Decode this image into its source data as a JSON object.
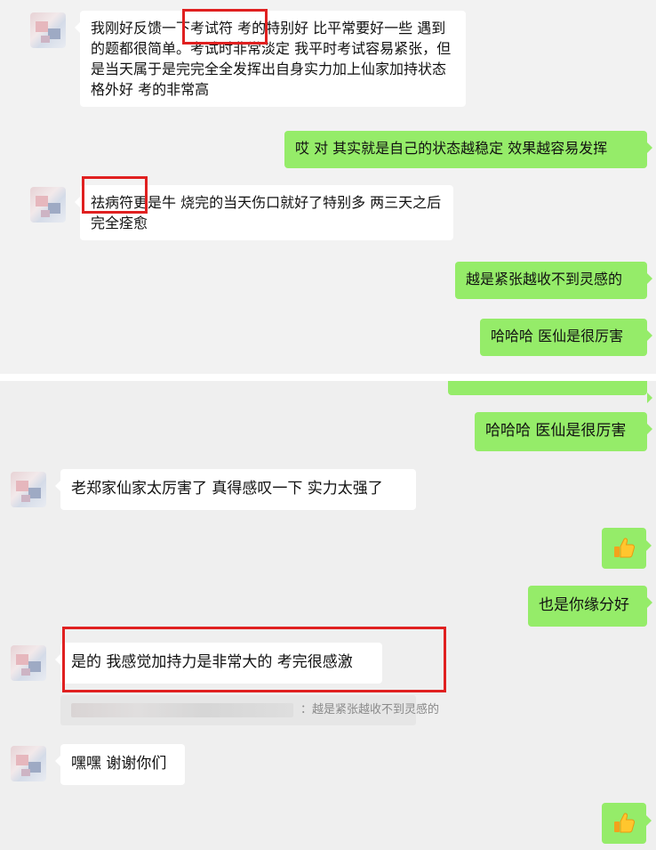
{
  "messages": [
    {
      "id": "m1",
      "side": "in",
      "text": "我刚好反馈一下考试符 考的特别好 比平常要好一些 遇到的题都很简单。考试时非常淡定 我平时考试容易紧张，但是当天属于是完完全全发挥出自身实力加上仙家加持状态格外好 考的非常高"
    },
    {
      "id": "m2",
      "side": "out",
      "text": "哎 对 其实就是自己的状态越稳定 效果越容易发挥"
    },
    {
      "id": "m3",
      "side": "in",
      "text": "祛病符更是牛 烧完的当天伤口就好了特别多 两三天之后完全痊愈"
    },
    {
      "id": "m4",
      "side": "out",
      "text": "越是紧张越收不到灵感的"
    },
    {
      "id": "m5",
      "side": "out",
      "text": "哈哈哈 医仙是很厉害"
    },
    {
      "id": "m6",
      "side": "out",
      "text": "哈哈哈 医仙是很厉害"
    },
    {
      "id": "m7",
      "side": "in",
      "text": "老郑家仙家太厉害了 真得感叹一下 实力太强了"
    },
    {
      "id": "m8",
      "side": "out",
      "emoji": "thumbs-up"
    },
    {
      "id": "m9",
      "side": "out",
      "text": "也是你缘分好"
    },
    {
      "id": "m10",
      "side": "in",
      "text": "是的 我感觉加持力是非常大的 考完很感激"
    },
    {
      "id": "m11",
      "side": "in",
      "text": "嘿嘿 谢谢你们"
    },
    {
      "id": "m12",
      "side": "out",
      "emoji": "thumbs-up"
    }
  ],
  "quote": {
    "text": "：越是紧张越收不到灵感的"
  },
  "colors": {
    "outgoing_bubble": "#95ec69",
    "incoming_bubble": "#ffffff",
    "highlight": "#e02020",
    "background": "#f2f2f2"
  }
}
